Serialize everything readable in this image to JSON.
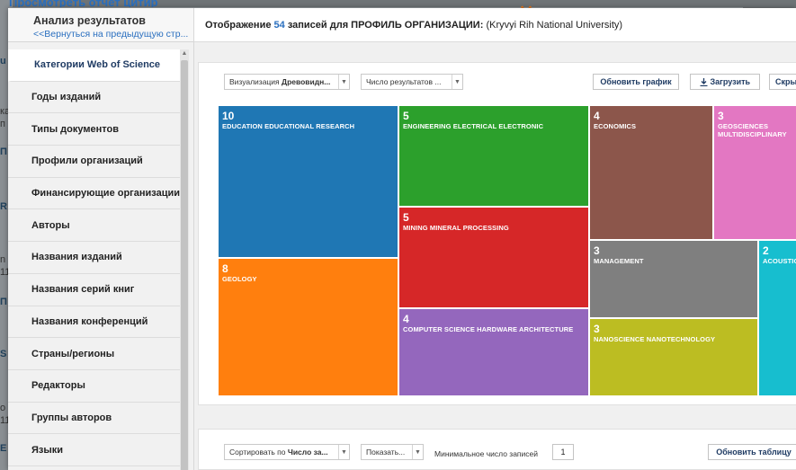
{
  "background": {
    "top_link": "Просмотреть отчет цитир",
    "fragments": [
      "u",
      "ка",
      "п",
      "П",
      "R",
      "n",
      "11",
      "П",
      "S",
      "о",
      "11",
      "Е"
    ]
  },
  "sidebar": {
    "title": "Анализ результатов",
    "back_link": "<<Вернуться на предыдущую стр...",
    "items": [
      {
        "label": "Категории Web of Science",
        "active": true
      },
      {
        "label": "Годы изданий"
      },
      {
        "label": "Типы документов"
      },
      {
        "label": "Профили организаций"
      },
      {
        "label": "Финансирующие организации"
      },
      {
        "label": "Авторы"
      },
      {
        "label": "Названия изданий"
      },
      {
        "label": "Названия серий книг"
      },
      {
        "label": "Названия конференций"
      },
      {
        "label": "Страны/регионы"
      },
      {
        "label": "Редакторы"
      },
      {
        "label": "Группы авторов"
      },
      {
        "label": "Языки"
      }
    ]
  },
  "header": {
    "prefix": "Отображение",
    "count": "54",
    "middle": "записей для ПРОФИЛЬ ОРГАНИЗАЦИИ:",
    "org": "(Kryvyi Rih National University)"
  },
  "viz_toolbar": {
    "viz_label": "Визуализация",
    "viz_value": "Древовидн...",
    "results_label": "Число результатов ...",
    "update_chart": "Обновить график",
    "download_icon": "download-icon",
    "download": "Загрузить",
    "hide": "Скрыть"
  },
  "treemap": {
    "tiles": [
      {
        "value": "10",
        "label": "EDUCATION EDUCATIONAL RESEARCH",
        "color": "#1f77b4"
      },
      {
        "value": "8",
        "label": "GEOLOGY",
        "color": "#ff7f0e"
      },
      {
        "value": "5",
        "label": "ENGINEERING ELECTRICAL ELECTRONIC",
        "color": "#2ca02c"
      },
      {
        "value": "5",
        "label": "MINING MINERAL PROCESSING",
        "color": "#d62728"
      },
      {
        "value": "4",
        "label": "COMPUTER SCIENCE HARDWARE ARCHITECTURE",
        "color": "#9467bd"
      },
      {
        "value": "4",
        "label": "ECONOMICS",
        "color": "#8c564b"
      },
      {
        "value": "3",
        "label": "GEOSCIENCES MULTIDISCIPLINARY",
        "color": "#e377c2"
      },
      {
        "value": "3",
        "label": "MANAGEMENT",
        "color": "#7f7f7f"
      },
      {
        "value": "3",
        "label": "NANOSCIENCE NANOTECHNOLOGY",
        "color": "#bcbd22"
      },
      {
        "value": "2",
        "label": "ACOUSTICS",
        "color": "#17becf"
      }
    ]
  },
  "table_toolbar": {
    "sort_label": "Сортировать по",
    "sort_value": "Число за...",
    "show_label": "Показать...",
    "min_label": "Минимальное число записей",
    "min_value": "1",
    "update_table": "Обновить таблицу"
  }
}
